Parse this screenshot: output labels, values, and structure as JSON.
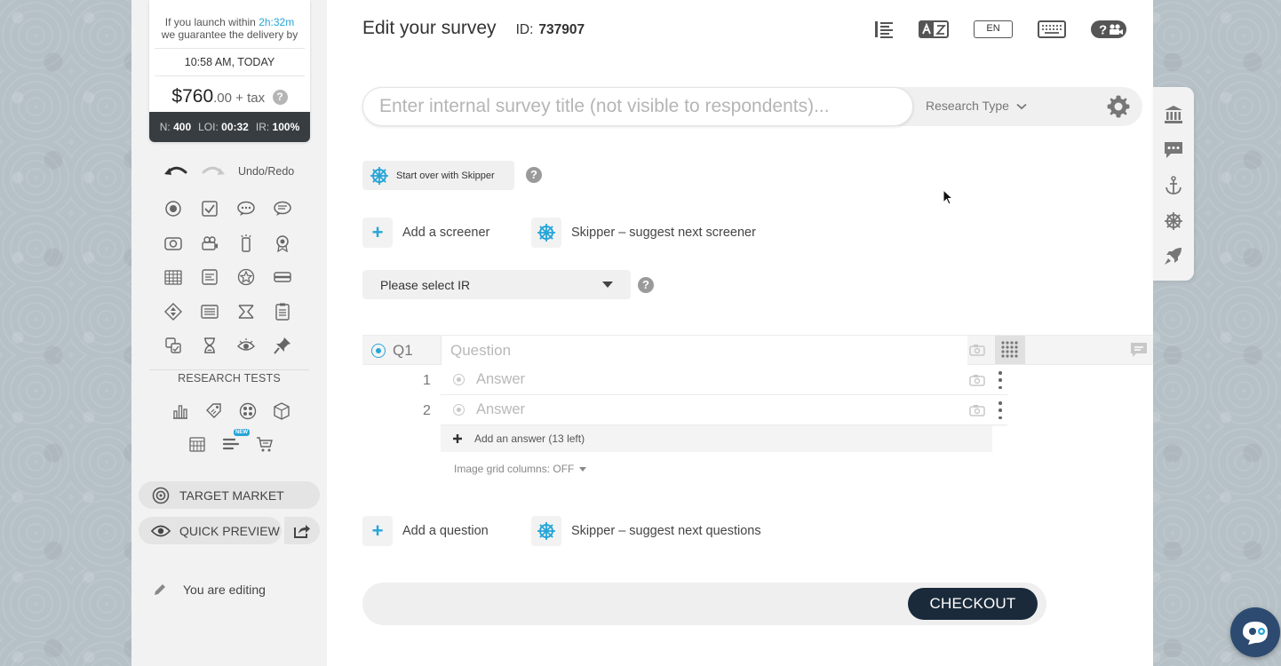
{
  "price_box": {
    "launch_line1_prefix": "If you launch within ",
    "launch_countdown": "2h:32m",
    "launch_line2": "we guarantee the delivery by",
    "delivery_time": "10:58 AM, TODAY",
    "price_main": "$760",
    "price_cents": ".00 + tax",
    "help": "?",
    "stats": {
      "n_label": "N:",
      "n_val": "400",
      "loi_label": "LOI:",
      "loi_val": "00:32",
      "ir_label": "IR:",
      "ir_val": "100%"
    }
  },
  "sidebar": {
    "undo_redo_label": "Undo/Redo",
    "question_type_icons": [
      "single-choice-icon",
      "multiple-choice-icon",
      "open-end-icon",
      "text-comment-icon",
      "image-icon",
      "video-icon",
      "mobile-tap-icon",
      "rating-badge-icon",
      "matrix-icon",
      "ranking-icon",
      "star-rating-icon",
      "slider-icon",
      "max-diff-icon",
      "text-block-icon",
      "card-sort-icon",
      "checklist-icon",
      "image-choice-icon",
      "timer-icon",
      "eye-tracking-icon",
      "pin-icon"
    ],
    "research_tests_label": "RESEARCH TESTS",
    "research_test_icons": [
      "bar-chart-icon",
      "price-tag-icon",
      "concept-test-icon",
      "package-test-icon",
      "grid-test-icon",
      "new-test-icon",
      "cart-test-icon"
    ],
    "new_badge": "NEW",
    "target_market": "TARGET MARKET",
    "quick_preview": "QUICK PREVIEW",
    "editing_label": "You are editing"
  },
  "header": {
    "title": "Edit your survey",
    "id_label": "ID:",
    "id_value": "737907",
    "language": "EN"
  },
  "survey": {
    "title_placeholder": "Enter internal survey title (not visible to respondents)...",
    "research_type": "Research Type",
    "skipper_start": "Start over with Skipper",
    "add_screener": "Add a screener",
    "skipper_screener": "Skipper – suggest next screener",
    "ir_select": "Please select IR",
    "help": "?",
    "question": {
      "label": "Q1",
      "placeholder": "Question",
      "answers": [
        {
          "num": "1",
          "placeholder": "Answer"
        },
        {
          "num": "2",
          "placeholder": "Answer"
        }
      ],
      "add_answer": "Add an answer (13 left)",
      "image_grid": "Image grid columns: OFF"
    },
    "add_question": "Add a question",
    "skipper_questions": "Skipper – suggest next questions",
    "checkout": "CHECKOUT"
  },
  "colors": {
    "accent": "#26a5d8",
    "dark_button": "#1b2a3a",
    "stats_bar": "#383d41"
  }
}
